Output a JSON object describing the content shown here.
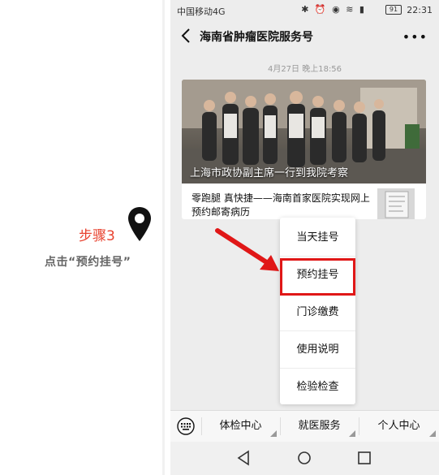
{
  "annotation": {
    "step": "步骤3",
    "instruction": "点击“预约挂号”"
  },
  "status": {
    "carrier": "中国移动4G",
    "battery": "91",
    "time": "22:31"
  },
  "chat": {
    "title": "海南省肿瘤医院服务号",
    "timestamp": "4月27日 晚上18:56"
  },
  "article": {
    "hero_title": "上海市政协副主席一行到我院考察",
    "sub_title": "零跑腿 真快捷——海南首家医院实现网上预约邮寄病历"
  },
  "popup_menu": {
    "items": [
      "当天挂号",
      "预约挂号",
      "门诊缴费",
      "使用说明",
      "检验检查"
    ]
  },
  "bottom_menu": {
    "items": [
      "体检中心",
      "就医服务",
      "个人中心"
    ]
  },
  "colors": {
    "annotation_red": "#e8412e",
    "highlight_red": "#e01717"
  }
}
